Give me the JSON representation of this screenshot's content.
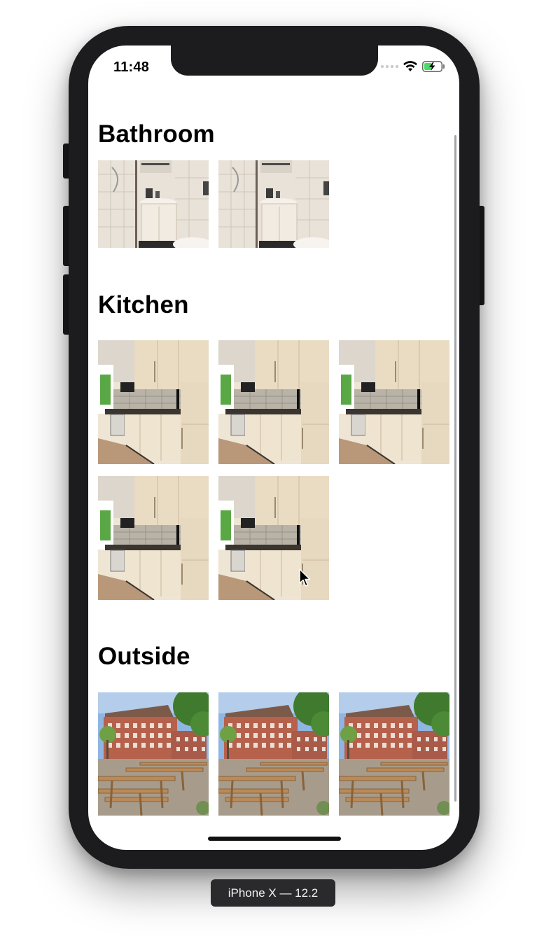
{
  "status_bar": {
    "time": "11:48"
  },
  "sections": [
    {
      "title": "Bathroom",
      "photo_type": "bathroom",
      "photo_count": 2
    },
    {
      "title": "Kitchen",
      "photo_type": "kitchen",
      "photo_count": 5
    },
    {
      "title": "Outside",
      "photo_type": "outside",
      "photo_count": 3
    }
  ],
  "device_label": "iPhone X — 12.2",
  "colors": {
    "frame": "#1c1c1e",
    "background": "#ffffff",
    "battery": "#4cd964"
  }
}
